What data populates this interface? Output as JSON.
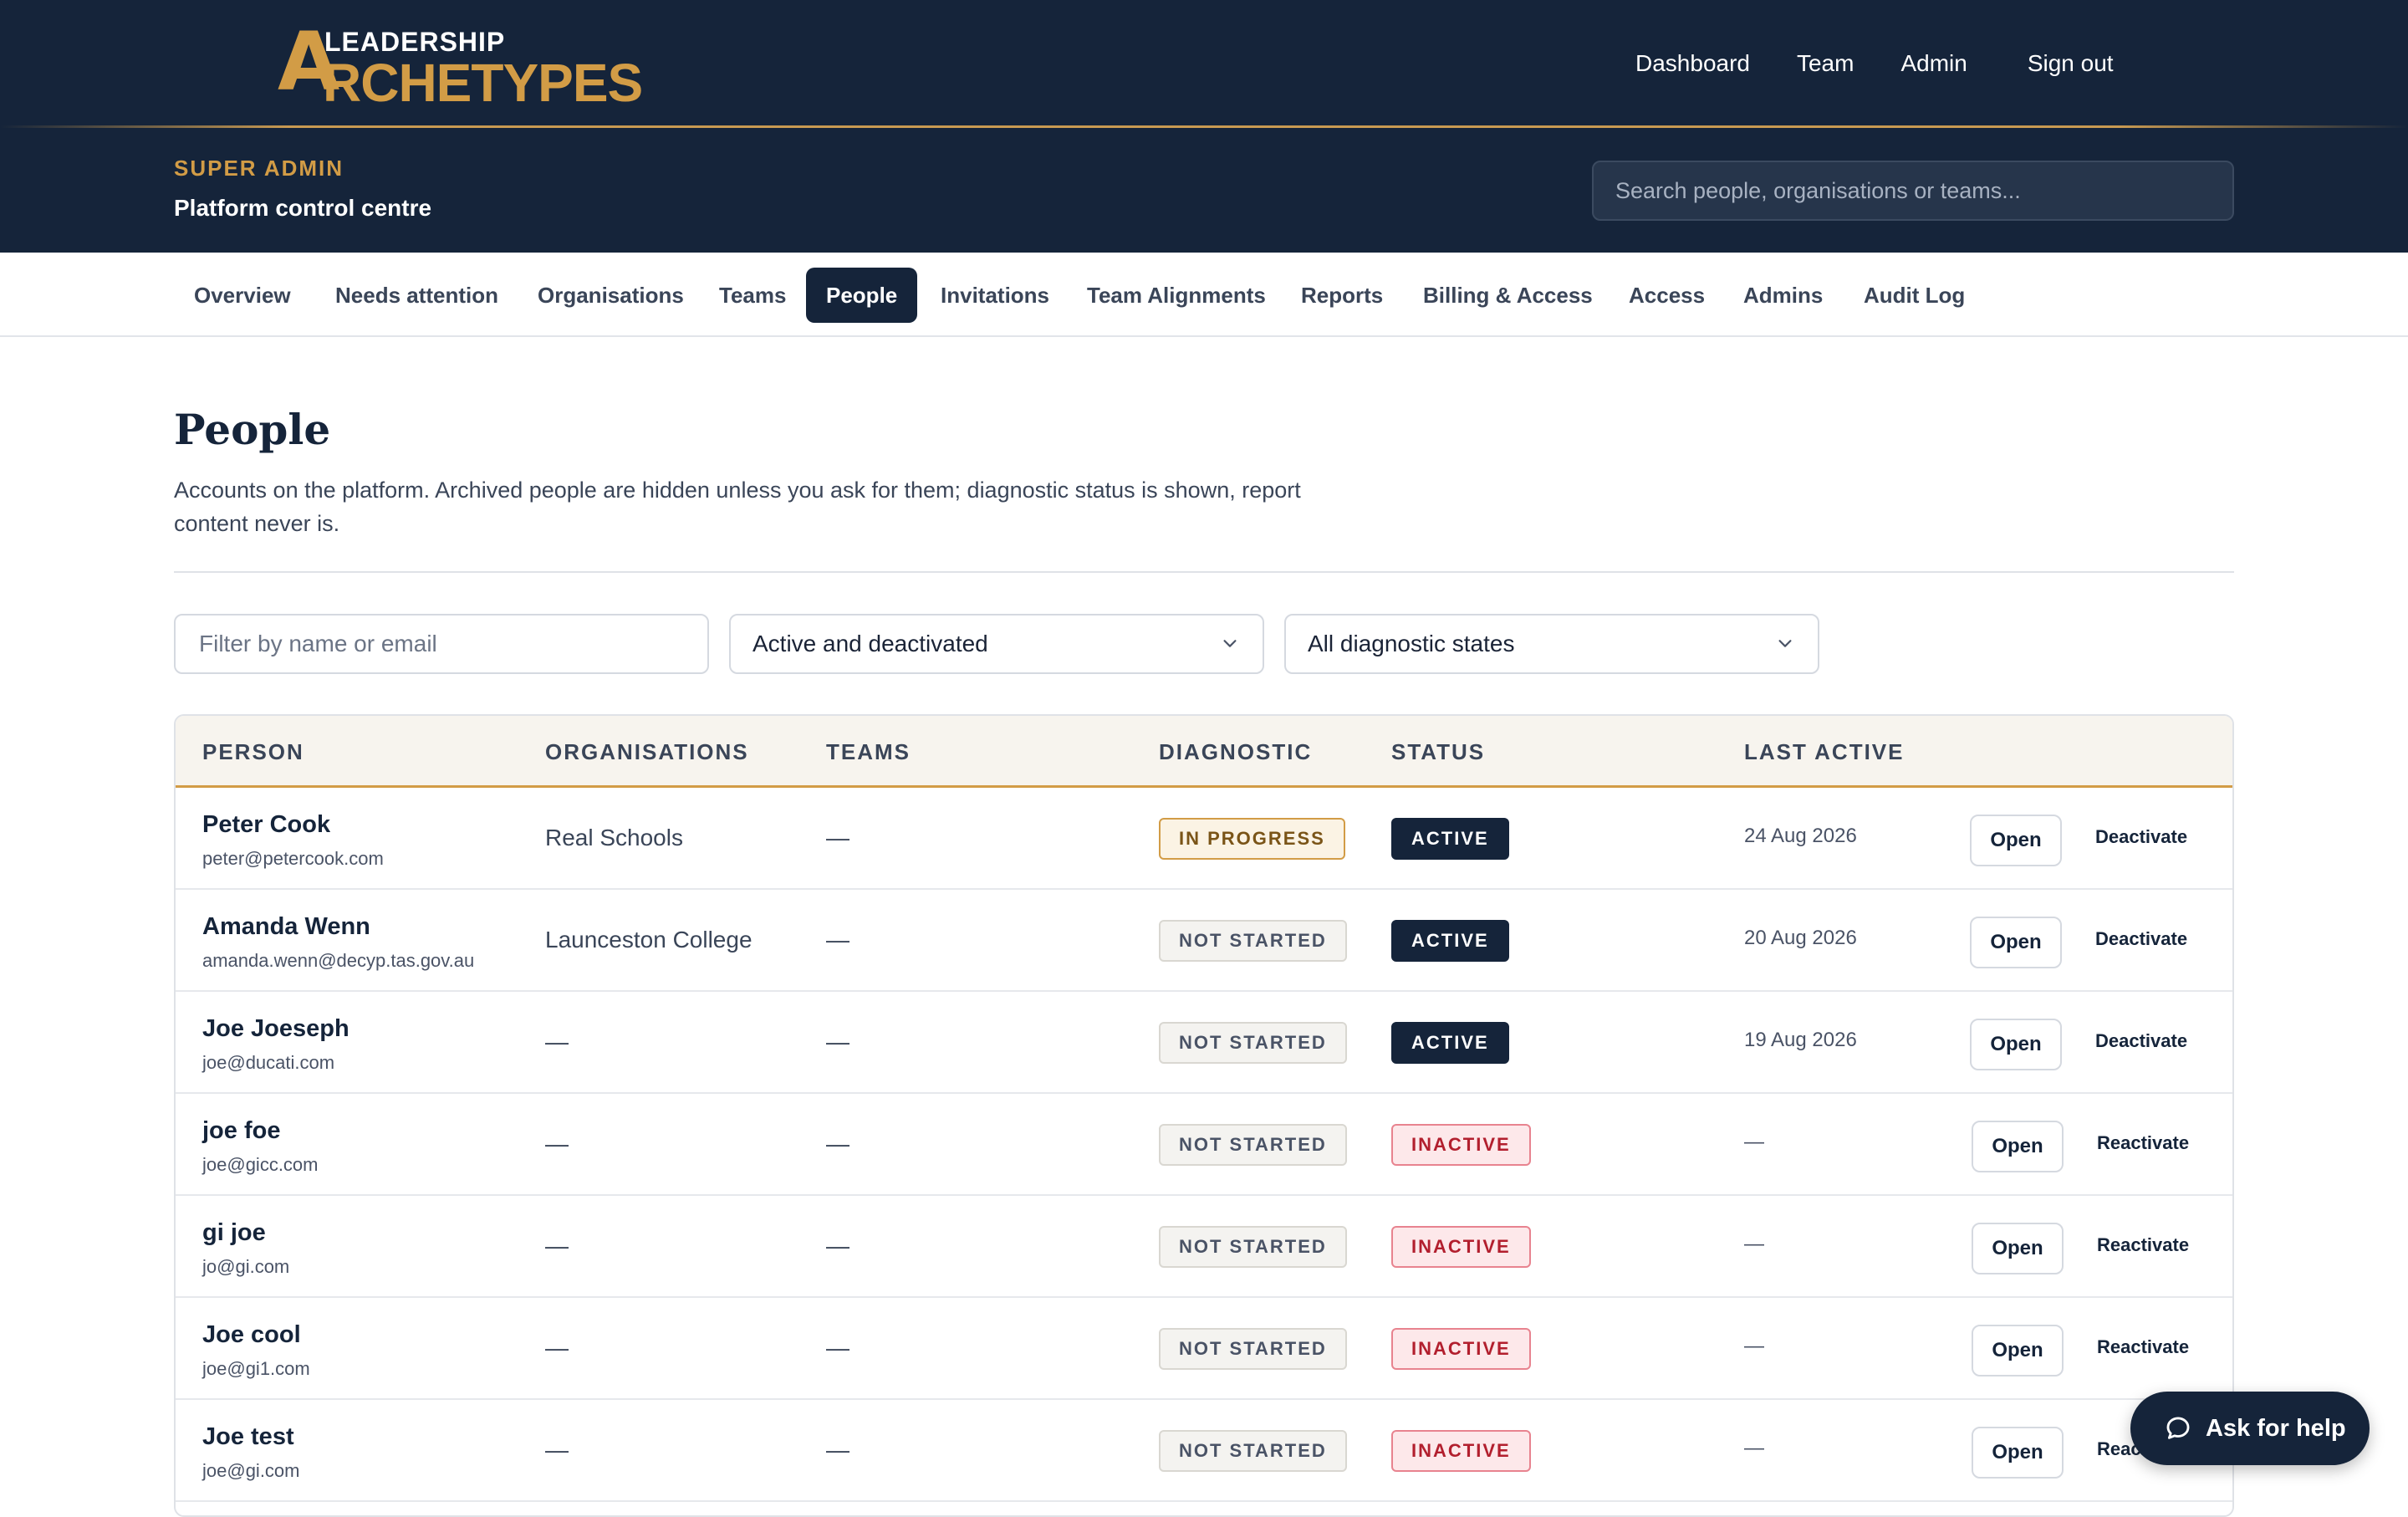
{
  "brand": {
    "line1": "LEADERSHIP",
    "letter_a": "A",
    "line2": "RCHETYPES",
    "gold": "#d29c46",
    "navy": "#15243a"
  },
  "top_nav": {
    "dashboard": "Dashboard",
    "team": "Team",
    "admin": "Admin",
    "sign_out": "Sign out"
  },
  "header": {
    "role": "SUPER ADMIN",
    "subtitle": "Platform control centre",
    "search_placeholder": "Search people, organisations or teams..."
  },
  "tabs": [
    {
      "label": "Overview",
      "active": false
    },
    {
      "label": "Needs attention",
      "active": false
    },
    {
      "label": "Organisations",
      "active": false
    },
    {
      "label": "Teams",
      "active": false
    },
    {
      "label": "People",
      "active": true
    },
    {
      "label": "Invitations",
      "active": false
    },
    {
      "label": "Team Alignments",
      "active": false
    },
    {
      "label": "Reports",
      "active": false
    },
    {
      "label": "Billing & Access",
      "active": false
    },
    {
      "label": "Access",
      "active": false
    },
    {
      "label": "Admins",
      "active": false
    },
    {
      "label": "Audit Log",
      "active": false
    }
  ],
  "page": {
    "title": "People",
    "description": "Accounts on the platform. Archived people are hidden unless you ask for them; diagnostic status is shown, report content never is."
  },
  "filters": {
    "name_placeholder": "Filter by name or email",
    "status_selected": "Active and deactivated",
    "diagnostic_selected": "All diagnostic states"
  },
  "table": {
    "headers": {
      "person": "PERSON",
      "organisations": "ORGANISATIONS",
      "teams": "TEAMS",
      "diagnostic": "DIAGNOSTIC",
      "status": "STATUS",
      "last_active": "LAST ACTIVE"
    },
    "open_label": "Open",
    "rows": [
      {
        "name": "Peter Cook",
        "email": "peter@petercook.com",
        "org": "Real Schools",
        "teams": "—",
        "diagnostic": "IN PROGRESS",
        "status": "ACTIVE",
        "last_active": "24 Aug 2026",
        "action": "Deactivate"
      },
      {
        "name": "Amanda Wenn",
        "email": "amanda.wenn@decyp.tas.gov.au",
        "org": "Launceston College",
        "teams": "—",
        "diagnostic": "NOT STARTED",
        "status": "ACTIVE",
        "last_active": "20 Aug 2026",
        "action": "Deactivate"
      },
      {
        "name": "Joe Joeseph",
        "email": "joe@ducati.com",
        "org": "—",
        "teams": "—",
        "diagnostic": "NOT STARTED",
        "status": "ACTIVE",
        "last_active": "19 Aug 2026",
        "action": "Deactivate"
      },
      {
        "name": "joe foe",
        "email": "joe@gicc.com",
        "org": "—",
        "teams": "—",
        "diagnostic": "NOT STARTED",
        "status": "INACTIVE",
        "last_active": "—",
        "action": "Reactivate"
      },
      {
        "name": "gi joe",
        "email": "jo@gi.com",
        "org": "—",
        "teams": "—",
        "diagnostic": "NOT STARTED",
        "status": "INACTIVE",
        "last_active": "—",
        "action": "Reactivate"
      },
      {
        "name": "Joe cool",
        "email": "joe@gi1.com",
        "org": "—",
        "teams": "—",
        "diagnostic": "NOT STARTED",
        "status": "INACTIVE",
        "last_active": "—",
        "action": "Reactivate"
      },
      {
        "name": "Joe test",
        "email": "joe@gi.com",
        "org": "—",
        "teams": "—",
        "diagnostic": "NOT STARTED",
        "status": "INACTIVE",
        "last_active": "—",
        "action": "Reactivate"
      }
    ]
  },
  "help": {
    "label": "Ask for help",
    "icon": "chat-bubble-icon"
  },
  "icons": {
    "dropdown": "chevron-down-icon"
  }
}
